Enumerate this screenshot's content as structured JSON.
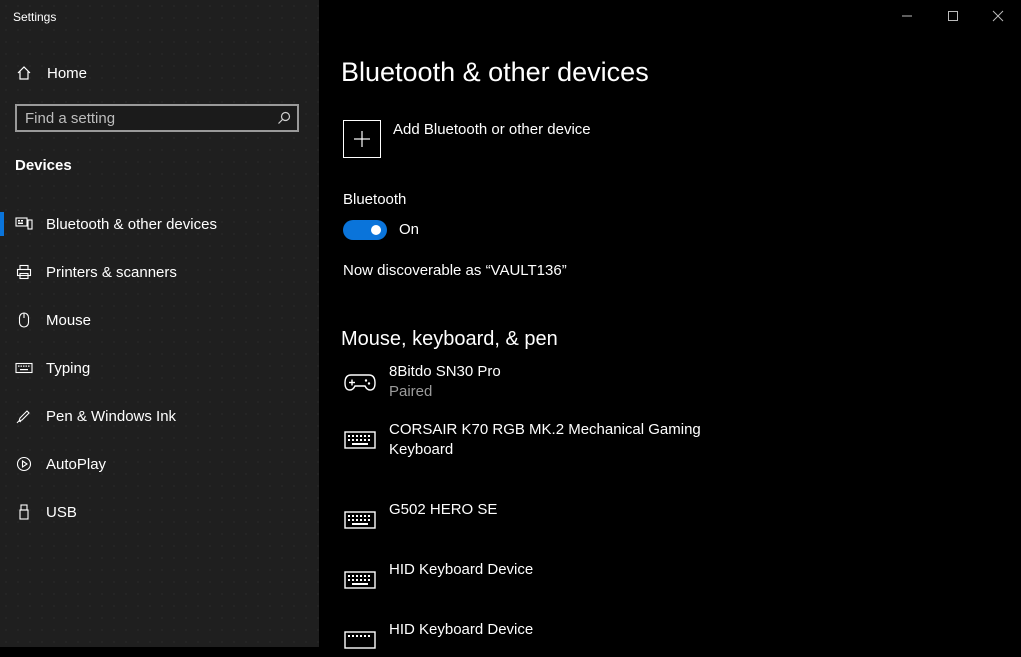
{
  "window": {
    "title": "Settings"
  },
  "sidebar": {
    "home_label": "Home",
    "search_placeholder": "Find a setting",
    "section_title": "Devices",
    "items": [
      {
        "label": "Bluetooth & other devices",
        "icon": "bluetooth-devices-icon",
        "selected": true
      },
      {
        "label": "Printers & scanners",
        "icon": "printer-icon"
      },
      {
        "label": "Mouse",
        "icon": "mouse-icon"
      },
      {
        "label": "Typing",
        "icon": "keyboard-icon"
      },
      {
        "label": "Pen & Windows Ink",
        "icon": "pen-icon"
      },
      {
        "label": "AutoPlay",
        "icon": "autoplay-icon"
      },
      {
        "label": "USB",
        "icon": "usb-icon"
      }
    ]
  },
  "main": {
    "title": "Bluetooth & other devices",
    "add_device_label": "Add Bluetooth or other device",
    "bluetooth_label": "Bluetooth",
    "bluetooth_state": "On",
    "discoverable_text": "Now discoverable as “VAULT136”",
    "section_title": "Mouse, keyboard, & pen",
    "devices": [
      {
        "name": "8Bitdo SN30 Pro",
        "status": "Paired",
        "icon": "gamepad-icon"
      },
      {
        "name": "CORSAIR K70 RGB MK.2 Mechanical Gaming Keyboard",
        "status": "",
        "icon": "keyboard-icon"
      },
      {
        "name": "G502 HERO SE",
        "status": "",
        "icon": "keyboard-icon"
      },
      {
        "name": "HID Keyboard Device",
        "status": "",
        "icon": "keyboard-icon"
      },
      {
        "name": "HID Keyboard Device",
        "status": "",
        "icon": "keyboard-icon"
      }
    ]
  },
  "colors": {
    "accent": "#0a74da",
    "sidebar_bg": "#1f1f1f",
    "main_bg": "#000000",
    "secondary_text": "#9b9b9b"
  }
}
